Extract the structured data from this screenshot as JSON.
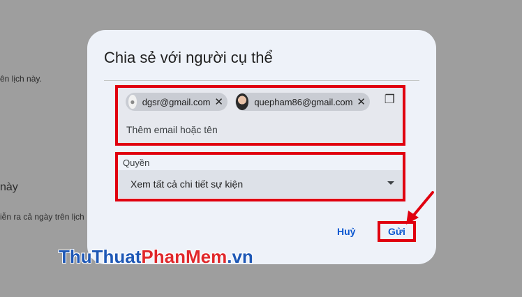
{
  "background": {
    "line1": "ên lịch này.",
    "heading": "này",
    "line2": "iễn ra cả ngày trên lịch"
  },
  "dialog": {
    "title": "Chia sẻ với người cụ thể",
    "recipients": [
      {
        "email": "dgsr@gmail.com",
        "avatar": "person-icon"
      },
      {
        "email": "quepham86@gmail.com",
        "avatar": "photo-avatar"
      }
    ],
    "email_placeholder": "Thêm email hoặc tên",
    "permission_label": "Quyền",
    "permission_value": "Xem tất cả chi tiết sự kiện",
    "cancel_label": "Huỷ",
    "send_label": "Gửi"
  },
  "watermark": {
    "part1": "ThuThuat",
    "part2": "PhanMem",
    "part3": ".vn"
  },
  "colors": {
    "highlight": "#e0000f",
    "accent": "#0b57d0",
    "dialog_bg": "#eef2f9",
    "overlay": "#9e9e9e"
  }
}
